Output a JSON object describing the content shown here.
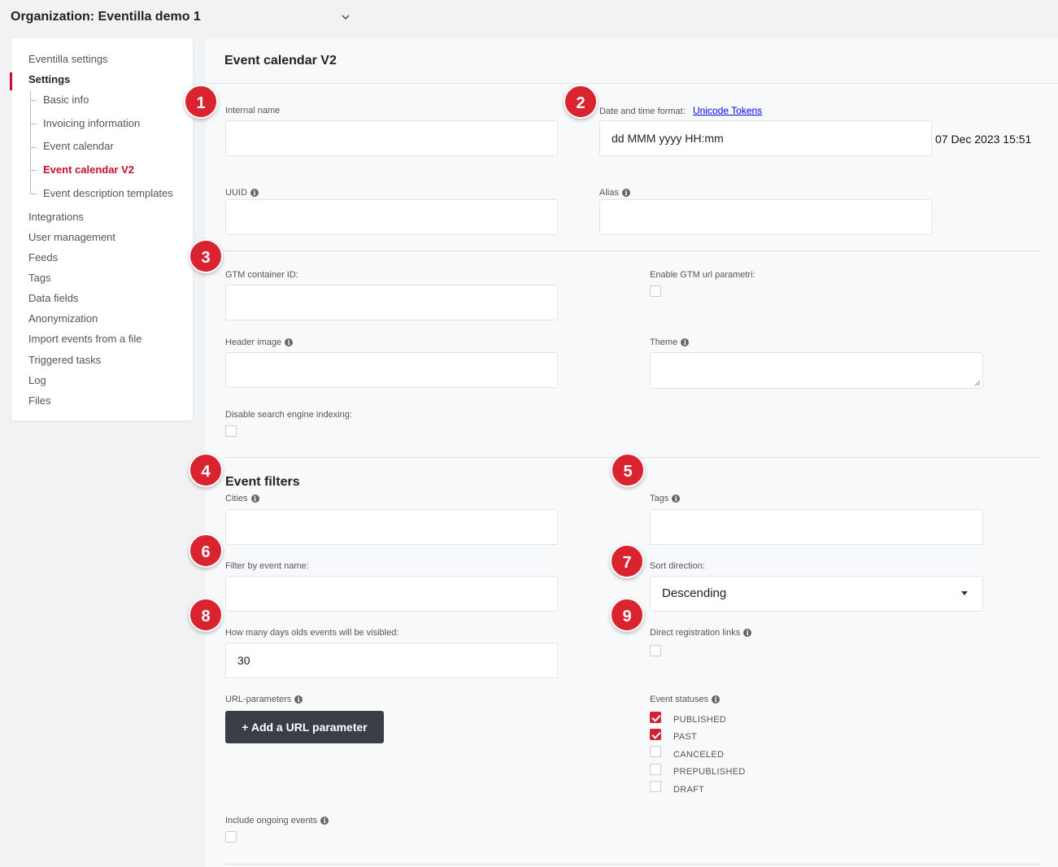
{
  "org": {
    "title": "Organization: Eventilla demo 1",
    "chevron_icon": "chevron-down-icon"
  },
  "sidebar": {
    "items": [
      {
        "label": "Eventilla settings"
      },
      {
        "label": "Settings"
      },
      {
        "label": "Basic info"
      },
      {
        "label": "Invoicing information"
      },
      {
        "label": "Event calendar"
      },
      {
        "label": "Event calendar V2"
      },
      {
        "label": "Event description templates"
      },
      {
        "label": "Integrations"
      },
      {
        "label": "User management"
      },
      {
        "label": "Feeds"
      },
      {
        "label": "Tags"
      },
      {
        "label": "Data fields"
      },
      {
        "label": "Anonymization"
      },
      {
        "label": "Import events from a file"
      },
      {
        "label": "Triggered tasks"
      },
      {
        "label": "Log"
      },
      {
        "label": "Files"
      }
    ]
  },
  "page": {
    "title": "Event calendar V2"
  },
  "form": {
    "internal_name": {
      "label": "Internal name",
      "value": ""
    },
    "date_format": {
      "label": "Date and time format:",
      "link": "Unicode Tokens",
      "value": "dd MMM yyyy HH:mm",
      "preview": "07 Dec 2023 15:51"
    },
    "uuid": {
      "label": "UUID",
      "value": ""
    },
    "alias": {
      "label": "Alias",
      "value": ""
    },
    "gtm_id": {
      "label": "GTM container ID:",
      "value": ""
    },
    "gtm_url": {
      "label": "Enable GTM url parametri:",
      "checked": false
    },
    "header_image": {
      "label": "Header image",
      "value": ""
    },
    "theme": {
      "label": "Theme",
      "value": ""
    },
    "disable_indexing": {
      "label": "Disable search engine indexing:",
      "checked": false
    },
    "filters_title": "Event filters",
    "cities": {
      "label": "Cities",
      "value": ""
    },
    "tags": {
      "label": "Tags",
      "value": ""
    },
    "filter_name": {
      "label": "Filter by event name:",
      "value": ""
    },
    "sort_direction": {
      "label": "Sort direction:",
      "value": "Descending"
    },
    "days_old": {
      "label": "How many days olds events will be visibled:",
      "value": "30"
    },
    "direct_links": {
      "label": "Direct registration links",
      "checked": false
    },
    "url_params": {
      "label": "URL-parameters",
      "button": "+ Add a URL parameter"
    },
    "event_statuses": {
      "label": "Event statuses",
      "options": [
        {
          "label": "PUBLISHED",
          "checked": true
        },
        {
          "label": "PAST",
          "checked": true
        },
        {
          "label": "CANCELED",
          "checked": false
        },
        {
          "label": "PREPUBLISHED",
          "checked": false
        },
        {
          "label": "DRAFT",
          "checked": false
        }
      ]
    },
    "ongoing": {
      "label": "Include ongoing events",
      "checked": false
    }
  },
  "badges": [
    "1",
    "2",
    "3",
    "4",
    "5",
    "6",
    "7",
    "8",
    "9"
  ],
  "colors": {
    "accent": "#c8102e",
    "badge": "#d9232f",
    "button_dark": "#3a3f47"
  }
}
